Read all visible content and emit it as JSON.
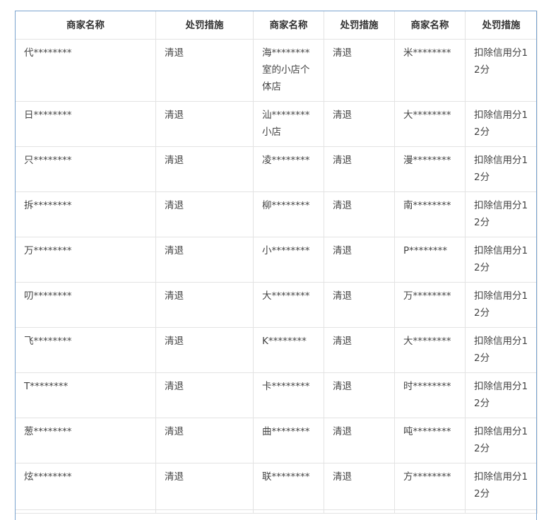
{
  "table": {
    "headers": [
      "商家名称",
      "处罚措施",
      "商家名称",
      "处罚措施",
      "商家名称",
      "处罚措施"
    ],
    "rows": [
      [
        "代********",
        "清退",
        "海********室的小店个体店",
        "清退",
        "米********",
        "扣除信用分12分"
      ],
      [
        "日********",
        "清退",
        "汕********小店",
        "清退",
        "大********",
        "扣除信用分12分"
      ],
      [
        "只********",
        "清退",
        "凌********",
        "清退",
        "漫********",
        "扣除信用分12分"
      ],
      [
        "拆********",
        "清退",
        "柳********",
        "清退",
        "南********",
        "扣除信用分12分"
      ],
      [
        "万********",
        "清退",
        "小********",
        "清退",
        "P********",
        "扣除信用分12分"
      ],
      [
        "叨********",
        "清退",
        "大********",
        "清退",
        "万********",
        "扣除信用分12分"
      ],
      [
        "飞********",
        "清退",
        "K********",
        "清退",
        "大********",
        "扣除信用分12分"
      ],
      [
        "T********",
        "清退",
        "卡********",
        "清退",
        "时********",
        "扣除信用分12分"
      ],
      [
        "葱********",
        "清退",
        "曲********",
        "清退",
        "吨********",
        "扣除信用分12分"
      ],
      [
        "炫********",
        "清退",
        "联********",
        "清退",
        "方********",
        "扣除信用分12分"
      ]
    ]
  },
  "colors": {
    "frame_border": "#7aa3cf",
    "cell_border": "#e3e3e3",
    "text": "#444444",
    "header_text": "#333333"
  }
}
